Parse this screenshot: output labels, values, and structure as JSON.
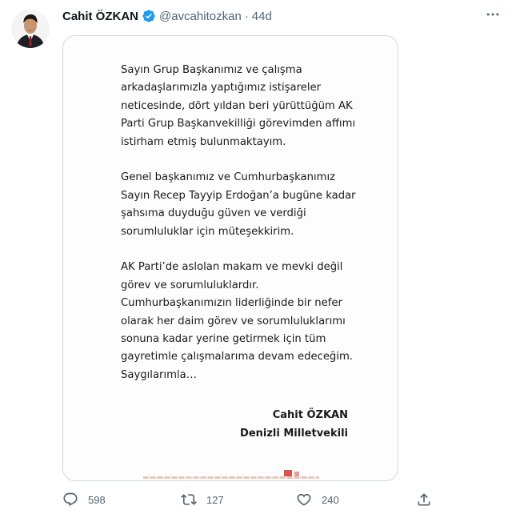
{
  "tweet": {
    "author_name": "Cahit ÖZKAN",
    "handle": "@avcahitozkan",
    "separator": "·",
    "time": "44d",
    "verified_icon": "verified-badge-icon",
    "more_icon": "more-options-icon"
  },
  "document": {
    "paragraphs": [
      "Sayın Grup Başkanımız ve çalışma arkadaşlarımızla yaptığımız istişareler neticesinde, dört yıldan beri yürüttüğüm AK Parti Grup Başkanvekilliği görevimden affımı istirham etmiş bulunmaktayım.",
      "Genel başkanımız ve Cumhurbaşkanımız Sayın Recep Tayyip Erdoğan’a bugüne kadar şahsıma duyduğu güven ve verdiği sorumluluklar için müteşekkirim.",
      "AK Parti’de aslolan makam ve mevki değil görev ve sorumluluklardır. Cumhurbaşkanımızın liderliğinde bir nefer olarak her daim görev ve sorumluluklarımı sonuna kadar yerine getirmek için tüm gayretimle çalışmalarıma devam edeceğim."
    ],
    "closing": "Saygılarımla…",
    "signature_name": "Cahit ÖZKAN",
    "signature_title": "Denizli Milletvekili"
  },
  "actions": {
    "reply_count": "598",
    "retweet_count": "127",
    "like_count": "240"
  },
  "colors": {
    "verified": "#1d9bf0",
    "muted": "#536471",
    "border": "#cfd9de"
  }
}
